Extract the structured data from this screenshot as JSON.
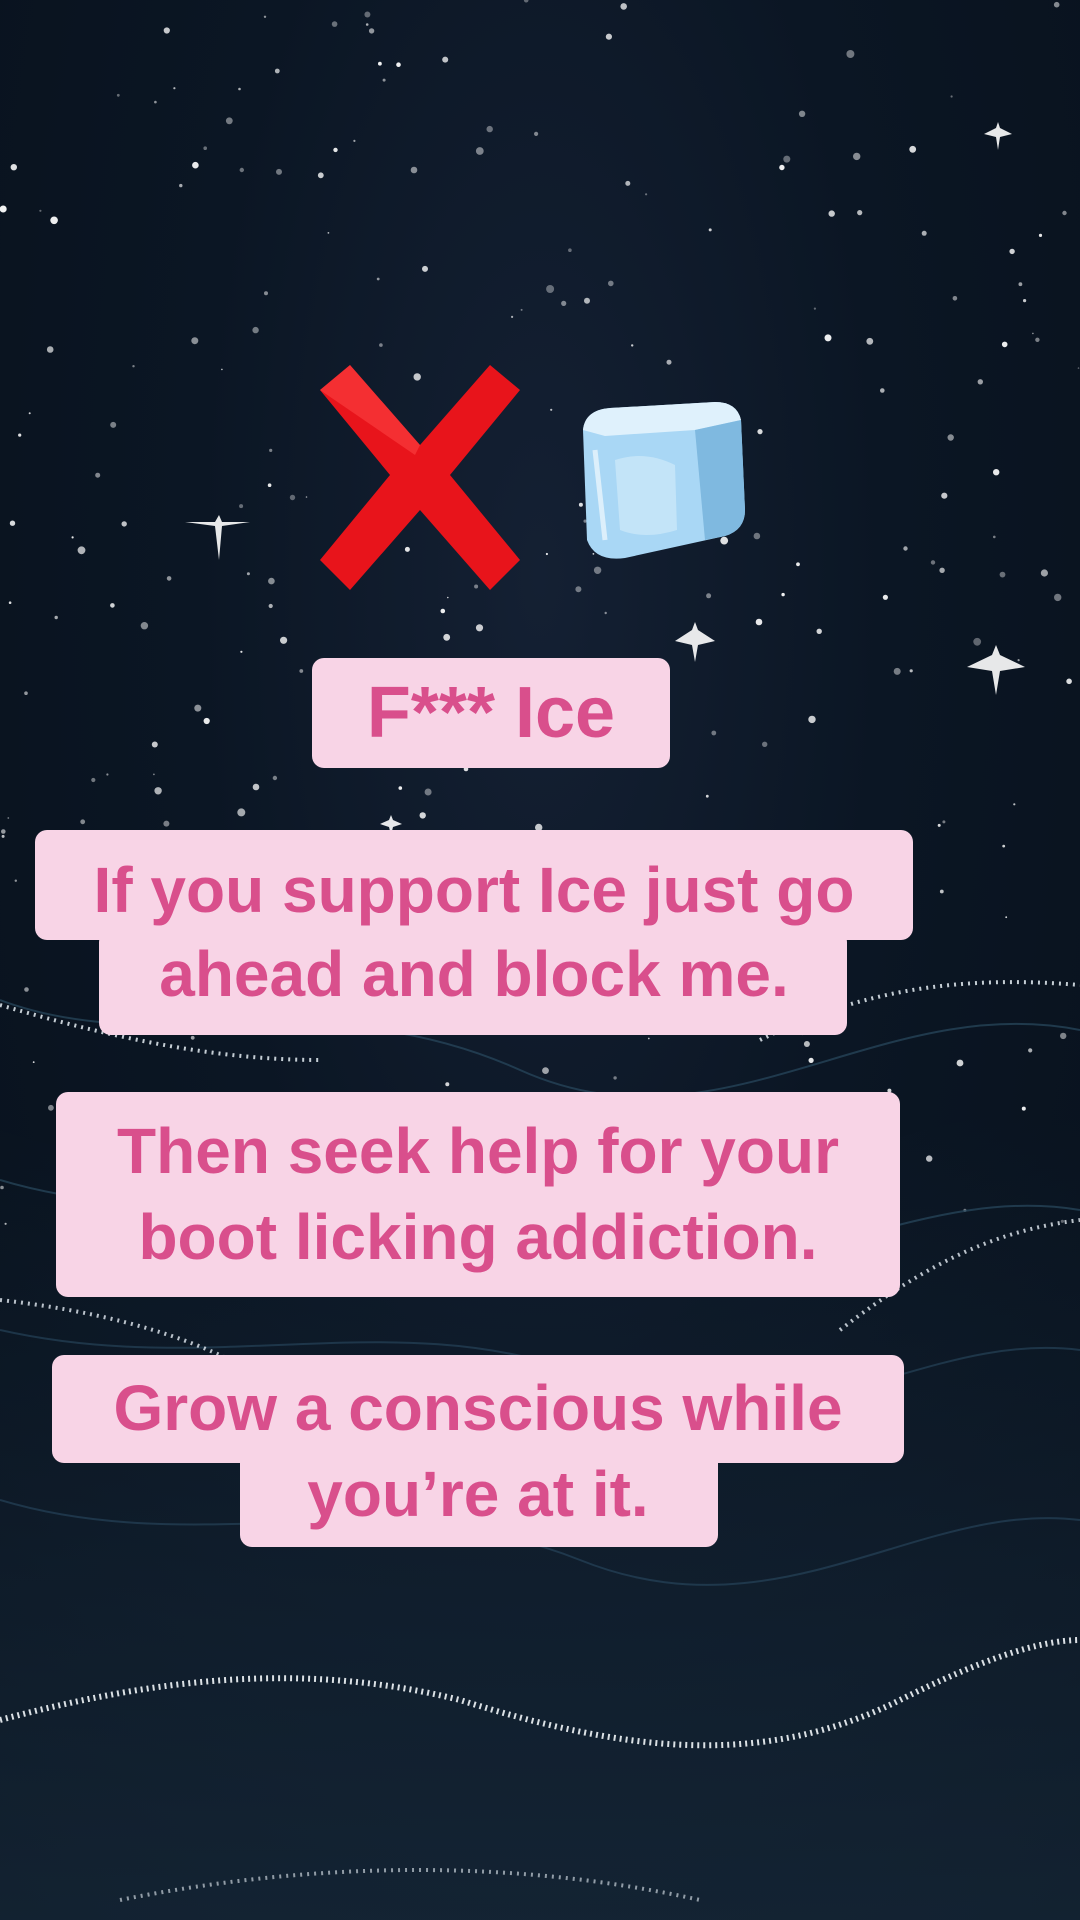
{
  "colors": {
    "caption_background": "#f8d4e6",
    "caption_text": "#d94f8c",
    "sky": "#0b1624",
    "cross": "#e8141b",
    "ice": "#a9d7f5"
  },
  "icons": [
    "cross-mark-icon",
    "ice-cube-icon"
  ],
  "captions": {
    "title": "F*** Ice",
    "block1": [
      "If you support Ice just go",
      "ahead and block me."
    ],
    "block2": [
      "Then seek help for your",
      "boot licking addiction."
    ],
    "block3": [
      "Grow a conscious while",
      "you’re at it."
    ]
  }
}
